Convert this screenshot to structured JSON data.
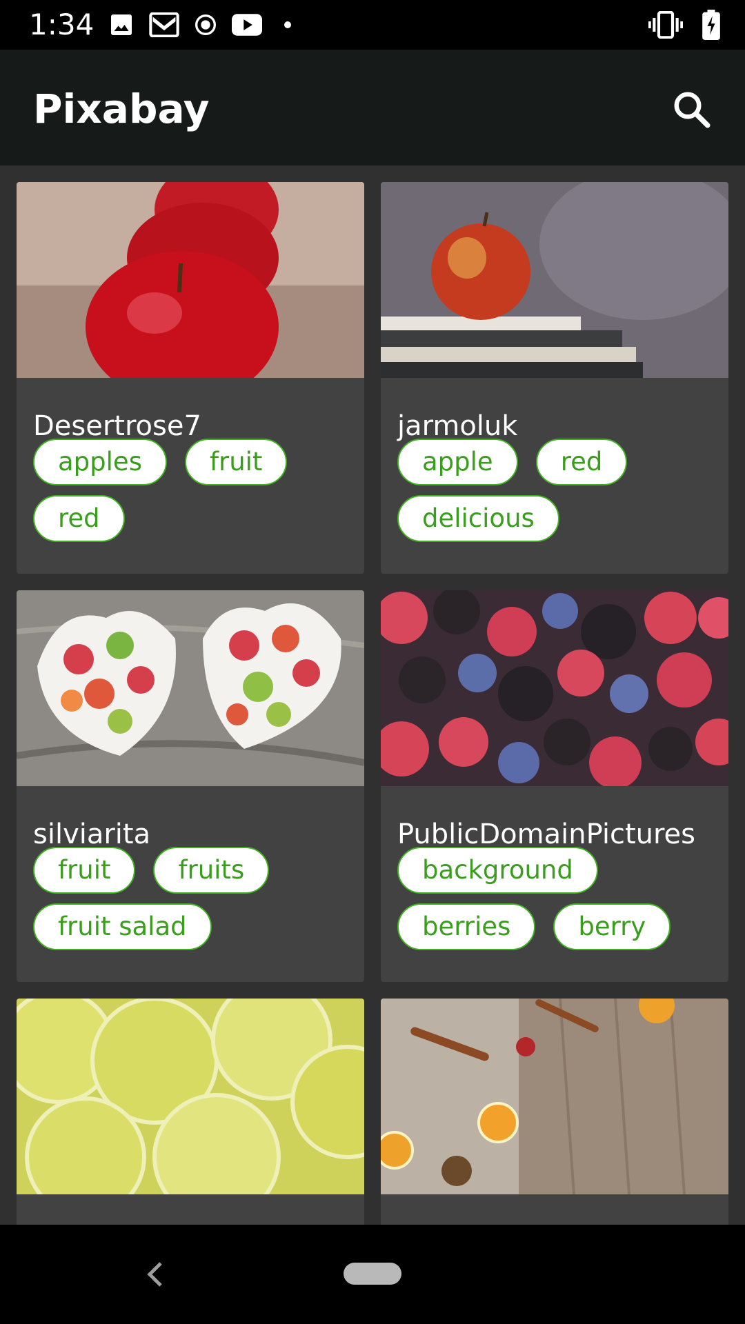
{
  "status_bar": {
    "time": "1:34",
    "left_icons": [
      "gallery-icon",
      "gmail-icon",
      "record-icon",
      "youtube-icon",
      "dot-icon"
    ],
    "right_icons": [
      "vibrate-icon",
      "battery-charging-icon"
    ]
  },
  "app_bar": {
    "title": "Pixabay",
    "search_icon": "search-icon"
  },
  "cards": [
    {
      "user": "Desertrose7",
      "tags": [
        "apples",
        "fruit",
        "red"
      ],
      "image": "red-apples-row"
    },
    {
      "user": "jarmoluk",
      "tags": [
        "apple",
        "red",
        "delicious"
      ],
      "image": "apple-on-books"
    },
    {
      "user": "silviarita",
      "tags": [
        "fruit",
        "fruits",
        "fruit salad"
      ],
      "image": "heart-bowls-fruit"
    },
    {
      "user": "PublicDomainPictures",
      "tags": [
        "background",
        "berries",
        "berry"
      ],
      "image": "mixed-berries"
    },
    {
      "user": "",
      "tags": [],
      "image": "lime-slices"
    },
    {
      "user": "",
      "tags": [],
      "image": "spices-oranges"
    }
  ],
  "nav_bar": {
    "back_icon": "back-icon",
    "home_icon": "home-pill-icon"
  },
  "colors": {
    "app_bar": "#161b19",
    "content_bg": "#303030",
    "card_bg": "#424242",
    "chip_text": "#3a9d1e",
    "chip_border": "#3fb021"
  }
}
